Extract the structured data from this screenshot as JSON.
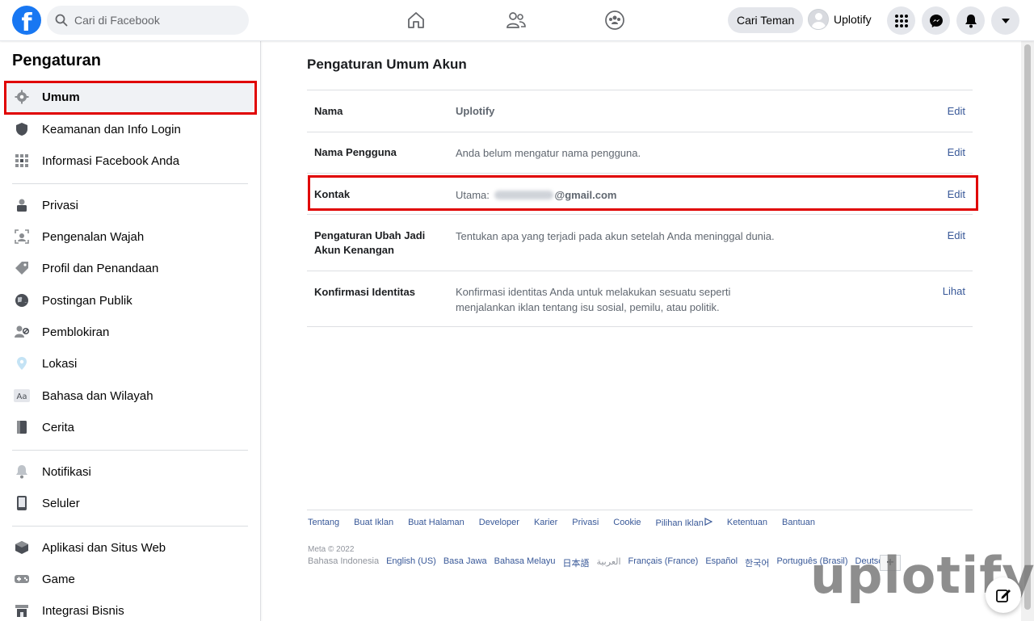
{
  "topbar": {
    "logo": "f",
    "search_placeholder": "Cari di Facebook",
    "find_friends": "Cari Teman",
    "profile_name": "Uplotify",
    "icons": [
      "home-icon",
      "friends-icon",
      "groups-icon",
      "menu-grid-icon",
      "messenger-icon",
      "notifications-icon",
      "account-dropdown-icon"
    ]
  },
  "sidebar": {
    "title": "Pengaturan",
    "items": [
      {
        "label": "Umum",
        "icon": "gear-icon",
        "active": true
      },
      {
        "label": "Keamanan dan Info Login",
        "icon": "shield-icon"
      },
      {
        "label": "Informasi Facebook Anda",
        "icon": "grid-icon"
      },
      {
        "label": "Privasi",
        "icon": "lock-person-icon"
      },
      {
        "label": "Pengenalan Wajah",
        "icon": "face-icon"
      },
      {
        "label": "Profil dan Penandaan",
        "icon": "tag-icon"
      },
      {
        "label": "Postingan Publik",
        "icon": "globe-icon"
      },
      {
        "label": "Pemblokiran",
        "icon": "block-user-icon"
      },
      {
        "label": "Lokasi",
        "icon": "location-pin-icon"
      },
      {
        "label": "Bahasa dan Wilayah",
        "icon": "language-icon"
      },
      {
        "label": "Cerita",
        "icon": "book-icon"
      },
      {
        "label": "Notifikasi",
        "icon": "bell-icon"
      },
      {
        "label": "Seluler",
        "icon": "phone-icon"
      },
      {
        "label": "Aplikasi dan Situs Web",
        "icon": "cube-icon"
      },
      {
        "label": "Game",
        "icon": "gamepad-icon"
      },
      {
        "label": "Integrasi Bisnis",
        "icon": "business-icon"
      }
    ]
  },
  "main": {
    "title": "Pengaturan Umum Akun",
    "rows": [
      {
        "label": "Nama",
        "value": "Uplotify",
        "action": "Edit"
      },
      {
        "label": "Nama Pengguna",
        "value": "Anda belum mengatur nama pengguna.",
        "action": "Edit"
      },
      {
        "label": "Kontak",
        "value_prefix": "Utama: ",
        "value_suffix": "@gmail.com",
        "action": "Edit"
      },
      {
        "label": "Pengaturan Ubah Jadi Akun Kenangan",
        "value": "Tentukan apa yang terjadi pada akun setelah Anda meninggal dunia.",
        "action": "Edit"
      },
      {
        "label": "Konfirmasi Identitas",
        "value": "Konfirmasi identitas Anda untuk melakukan sesuatu seperti menjalankan iklan tentang isu sosial, pemilu, atau politik.",
        "action": "Lihat"
      }
    ]
  },
  "footer": {
    "links": [
      "Tentang",
      "Buat Iklan",
      "Buat Halaman",
      "Developer",
      "Karier",
      "Privasi",
      "Cookie",
      "Pilihan Iklan",
      "Ketentuan",
      "Bantuan"
    ],
    "meta": "Meta © 2022",
    "languages": [
      "Bahasa Indonesia",
      "English (US)",
      "Basa Jawa",
      "Bahasa Melayu",
      "日本語",
      "العربية",
      "Français (France)",
      "Español",
      "한국어",
      "Português (Brasil)",
      "Deutsch"
    ],
    "plus": "+"
  },
  "watermark": "uplotify",
  "colors": {
    "brand": "#1877f2",
    "link": "#385898",
    "highlight": "#e00000"
  }
}
